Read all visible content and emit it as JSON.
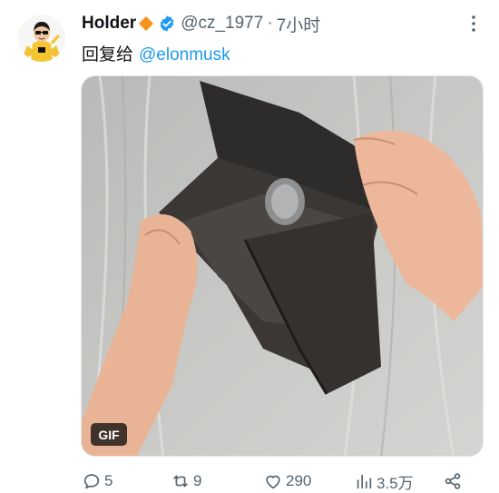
{
  "author": {
    "display_name": "Holder",
    "name_emoji": "orange-diamond-icon",
    "verified": true,
    "handle": "@cz_1977",
    "separator": "·",
    "time": "7小时"
  },
  "reply": {
    "prefix": "回复给",
    "mention": "@elonmusk"
  },
  "media": {
    "type": "gif",
    "badge": "GIF",
    "description_icon": "empty-wallet-image"
  },
  "actions": {
    "replies": "5",
    "retweets": "9",
    "likes": "290",
    "views": "3.5万"
  },
  "colors": {
    "accent": "#1d9bf0",
    "secondary_text": "#536471",
    "primary_text": "#0f1419",
    "diamond": "#f7931a"
  }
}
